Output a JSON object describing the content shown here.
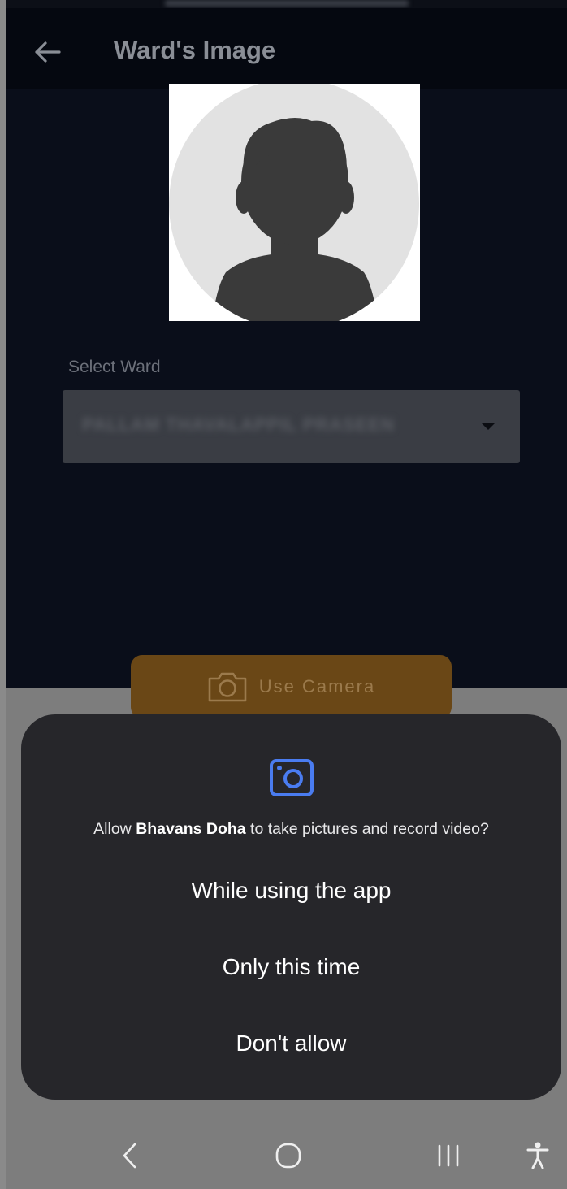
{
  "header": {
    "title": "Ward's Image"
  },
  "form": {
    "select_label": "Select Ward",
    "selected_ward": "PALLAM THAVALAPPIL PRASEEN"
  },
  "camera_button": {
    "label": "Use Camera"
  },
  "permission_dialog": {
    "message_prefix": "Allow ",
    "app_name": "Bhavans Doha",
    "message_suffix": " to take pictures and record video?",
    "options": [
      {
        "label": "While using the app"
      },
      {
        "label": "Only this time"
      },
      {
        "label": "Don't allow"
      }
    ],
    "accent_color": "#4a7cf0"
  },
  "navbar": {
    "icons": [
      "back-icon",
      "home-icon",
      "recents-icon",
      "accessibility-icon"
    ]
  }
}
